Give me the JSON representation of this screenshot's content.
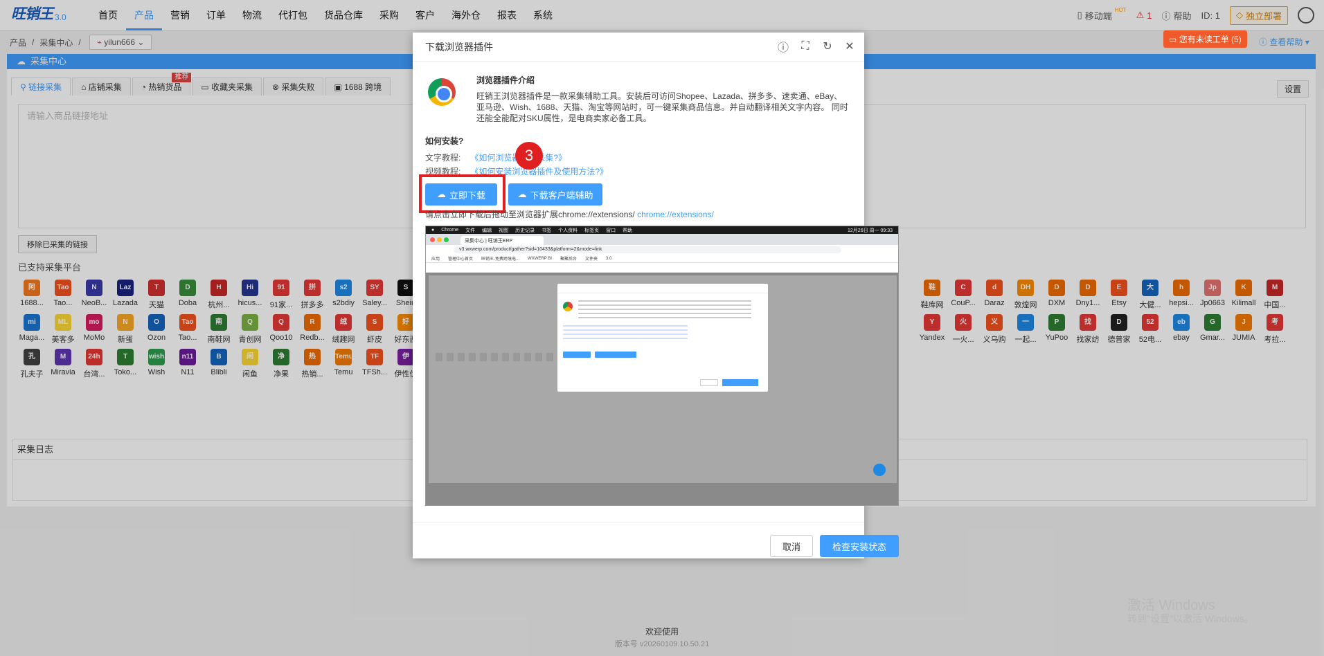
{
  "nav": {
    "logo_text": "旺销王",
    "logo_version": "3.0",
    "menu": [
      "首页",
      "产品",
      "营销",
      "订单",
      "物流",
      "代打包",
      "货品仓库",
      "采购",
      "客户",
      "海外仓",
      "报表",
      "系统"
    ],
    "mobile_label": "移动端",
    "mobile_badge": "HOT",
    "alert_count": "1",
    "help_label": "帮助",
    "id_label": "ID: 1",
    "deploy_label": "独立部署"
  },
  "ticket": {
    "label": "您有未读工单 (5)"
  },
  "help_right": "查看帮助",
  "breadcrumb": {
    "items": [
      "产品",
      "采集中心"
    ],
    "store_tag": "yilun666"
  },
  "panel": {
    "title": "采集中心"
  },
  "tabs": [
    "链接采集",
    "店铺采集",
    "热销货品",
    "收藏夹采集",
    "采集失败",
    "1688 跨境"
  ],
  "tab_badge": "推荐",
  "settings_label": "设置",
  "link_input_placeholder": "请输入商品链接地址",
  "remove_button": "移除已采集的链接",
  "supported_title": "已支持采集平台",
  "platforms_left": [
    {
      "name": "1688...",
      "color": "#f47a20",
      "abbr": "阿"
    },
    {
      "name": "Tao...",
      "color": "#f4511e",
      "abbr": "Tao"
    },
    {
      "name": "NeoB...",
      "color": "#3a3aaa",
      "abbr": "N"
    },
    {
      "name": "Lazada",
      "color": "#1a237e",
      "abbr": "Laz"
    },
    {
      "name": "天猫",
      "color": "#d32f2f",
      "abbr": "T"
    },
    {
      "name": "Doba",
      "color": "#388e3c",
      "abbr": "D"
    },
    {
      "name": "杭州...",
      "color": "#c62828",
      "abbr": "H"
    },
    {
      "name": "hicus...",
      "color": "#283593",
      "abbr": "Hi"
    },
    {
      "name": "91家...",
      "color": "#e53935",
      "abbr": "91"
    },
    {
      "name": "拼多多",
      "color": "#e53935",
      "abbr": "拼"
    },
    {
      "name": "s2bdiy",
      "color": "#1e88e5",
      "abbr": "s2"
    },
    {
      "name": "Saley...",
      "color": "#e53935",
      "abbr": "SY"
    },
    {
      "name": "Shein",
      "color": "#111111",
      "abbr": "S"
    },
    {
      "name": "Maga...",
      "color": "#1976d2",
      "abbr": "mi"
    },
    {
      "name": "美客多",
      "color": "#fdd835",
      "abbr": "ML"
    },
    {
      "name": "MoMo",
      "color": "#d81b60",
      "abbr": "mo"
    },
    {
      "name": "新蛋",
      "color": "#f9a825",
      "abbr": "N"
    },
    {
      "name": "Ozon",
      "color": "#1565c0",
      "abbr": "O"
    },
    {
      "name": "Tao...",
      "color": "#f4511e",
      "abbr": "Tao"
    },
    {
      "name": "南鞋网",
      "color": "#2e7d32",
      "abbr": "南"
    },
    {
      "name": "青创网",
      "color": "#7cb342",
      "abbr": "Q"
    },
    {
      "name": "Qoo10",
      "color": "#e53935",
      "abbr": "Q"
    },
    {
      "name": "Redb...",
      "color": "#ef6c00",
      "abbr": "R"
    },
    {
      "name": "绒趣网",
      "color": "#e53935",
      "abbr": "绒"
    },
    {
      "name": "虾皮",
      "color": "#f4511e",
      "abbr": "S"
    },
    {
      "name": "好东西",
      "color": "#fb8c00",
      "abbr": "好"
    },
    {
      "name": "孔夫子",
      "color": "#424242",
      "abbr": "孔"
    },
    {
      "name": "Miravia",
      "color": "#5e35b1",
      "abbr": "M"
    },
    {
      "name": "台湾...",
      "color": "#e53935",
      "abbr": "24h"
    },
    {
      "name": "Toko...",
      "color": "#2e7d32",
      "abbr": "T"
    },
    {
      "name": "Wish",
      "color": "#2e9e4f",
      "abbr": "wish"
    },
    {
      "name": "N11",
      "color": "#6a1b9a",
      "abbr": "n11"
    },
    {
      "name": "Blibli",
      "color": "#1565c0",
      "abbr": "B"
    },
    {
      "name": "闲鱼",
      "color": "#fdd835",
      "abbr": "闲"
    },
    {
      "name": "净果",
      "color": "#2e7d32",
      "abbr": "净"
    },
    {
      "name": "热销...",
      "color": "#ef6c00",
      "abbr": "热"
    },
    {
      "name": "Temu",
      "color": "#f57c00",
      "abbr": "Temu"
    },
    {
      "name": "TFSh...",
      "color": "#f4511e",
      "abbr": "TF"
    },
    {
      "name": "伊性优",
      "color": "#7b1fa2",
      "abbr": "伊"
    }
  ],
  "platforms_right": [
    {
      "name": "鞋库网",
      "color": "#ef6c00",
      "abbr": "鞋"
    },
    {
      "name": "CouP...",
      "color": "#e53935",
      "abbr": "C"
    },
    {
      "name": "Daraz",
      "color": "#f4511e",
      "abbr": "d"
    },
    {
      "name": "敦煌网",
      "color": "#fb8c00",
      "abbr": "DH"
    },
    {
      "name": "DXM",
      "color": "#ef6c00",
      "abbr": "D"
    },
    {
      "name": "Dny1...",
      "color": "#ef6c00",
      "abbr": "D"
    },
    {
      "name": "Etsy",
      "color": "#f4511e",
      "abbr": "E"
    },
    {
      "name": "大健...",
      "color": "#1565c0",
      "abbr": "大"
    },
    {
      "name": "hepsi...",
      "color": "#ef6c00",
      "abbr": "h"
    },
    {
      "name": "Jp0663",
      "color": "#e57373",
      "abbr": "Jp"
    },
    {
      "name": "Kilimall",
      "color": "#ef6c00",
      "abbr": "K"
    },
    {
      "name": "中国...",
      "color": "#c62828",
      "abbr": "M"
    },
    {
      "name": "Yandex",
      "color": "#e53935",
      "abbr": "Y"
    },
    {
      "name": "一火...",
      "color": "#e53935",
      "abbr": "火"
    },
    {
      "name": "义乌购",
      "color": "#f4511e",
      "abbr": "义"
    },
    {
      "name": "一起...",
      "color": "#1e88e5",
      "abbr": "一"
    },
    {
      "name": "YuPoo",
      "color": "#2e7d32",
      "abbr": "P"
    },
    {
      "name": "找家纺",
      "color": "#e53935",
      "abbr": "找"
    },
    {
      "name": "德普家",
      "color": "#212121",
      "abbr": "D"
    },
    {
      "name": "52电...",
      "color": "#e53935",
      "abbr": "52"
    },
    {
      "name": "ebay",
      "color": "#1e88e5",
      "abbr": "eb"
    },
    {
      "name": "Gmar...",
      "color": "#2e7d32",
      "abbr": "G"
    },
    {
      "name": "JUMIA",
      "color": "#f57c00",
      "abbr": "J"
    },
    {
      "name": "考拉...",
      "color": "#e53935",
      "abbr": "考"
    }
  ],
  "log_title": "采集日志",
  "footer": {
    "welcome": "欢迎使用",
    "version": "版本号 v20260109.10.50.21"
  },
  "watermark": {
    "line1": "激活 Windows",
    "line2": "转到\"设置\"以激活 Windows。"
  },
  "modal": {
    "title": "下载浏览器插件",
    "intro_title": "浏览器插件介绍",
    "intro_desc": "旺销王浏览器插件是一款采集辅助工具。安装后可访问Shopee、Lazada、拼多多、速卖通、eBay、亚马逊、Wish、1688、天猫、淘宝等网站时，可一键采集商品信息。并自动翻译相关文字内容。 同时还能全能配对SKU属性，是电商卖家必备工具。",
    "how_title": "如何安装?",
    "text_tutorial_label": "文字教程:",
    "text_tutorial_link": "《如何浏览器插件采集?》",
    "video_tutorial_label": "视频教程:",
    "video_tutorial_link": "《如何安装浏览器插件及使用方法?》",
    "download_button": "立即下载",
    "client_button": "下载客户端辅助",
    "hint_text": "请点击立即下载后拖动至浏览器扩展chrome://extensions/",
    "hint_link": "chrome://extensions/",
    "step_number": "3",
    "cancel_button": "取消",
    "check_button": "检查安装状态",
    "screenshot": {
      "menubar": [
        "Chrome",
        "文件",
        "编辑",
        "视图",
        "历史记录",
        "书签",
        "个人资料",
        "标签页",
        "窗口",
        "帮助"
      ],
      "clock": "12月26日 周一 09:33",
      "tab_title": "采集中心 | 旺销王ERP",
      "url": "v3.wxwerp.com/product/gather?sid=10433&platform=2&mode=link",
      "bookmarks": [
        "应用",
        "管理中心首页",
        "旺销王-免费跨境电...",
        "WXWERP BI",
        "聚聚后台",
        "文件夹",
        "3.0"
      ]
    }
  }
}
